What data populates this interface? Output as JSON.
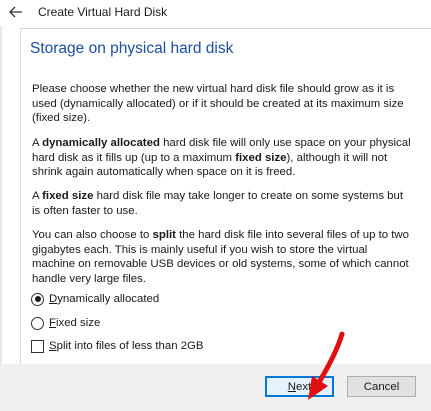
{
  "window": {
    "title": "Create Virtual Hard Disk"
  },
  "page": {
    "heading": "Storage on physical hard disk",
    "p1": "Please choose whether the new virtual hard disk file should grow as it is used (dynamically allocated) or if it should be created at its maximum size (fixed size).",
    "p2": {
      "a": "A ",
      "b": "dynamically allocated",
      "c": " hard disk file will only use space on your physical hard disk as it fills up (up to a maximum ",
      "d": "fixed size",
      "e": "), although it will not shrink again automatically when space on it is freed."
    },
    "p3": {
      "a": "A ",
      "b": "fixed size",
      "c": " hard disk file may take longer to create on some systems but is often faster to use."
    },
    "p4": {
      "a": "You can also choose to ",
      "b": "split",
      "c": " the hard disk file into several files of up to two gigabytes each. This is mainly useful if you wish to store the virtual machine on removable USB devices or old systems, some of which cannot handle very large files."
    }
  },
  "options": {
    "dynamic": {
      "mnemonic": "D",
      "rest": "ynamically allocated",
      "checked": true
    },
    "fixed": {
      "mnemonic": "F",
      "rest": "ixed size",
      "checked": false
    },
    "split": {
      "mnemonic": "S",
      "rest": "plit into files of less than 2GB",
      "checked": false
    }
  },
  "buttons": {
    "next": {
      "mnemonic": "N",
      "rest": "ext"
    },
    "cancel": "Cancel"
  },
  "colors": {
    "heading": "#1b4fa0",
    "focus_border": "#0078d7",
    "annotation_arrow": "#e01010"
  },
  "icons": {
    "back": "arrow-left-icon",
    "annotation": "red-arrow-icon"
  }
}
